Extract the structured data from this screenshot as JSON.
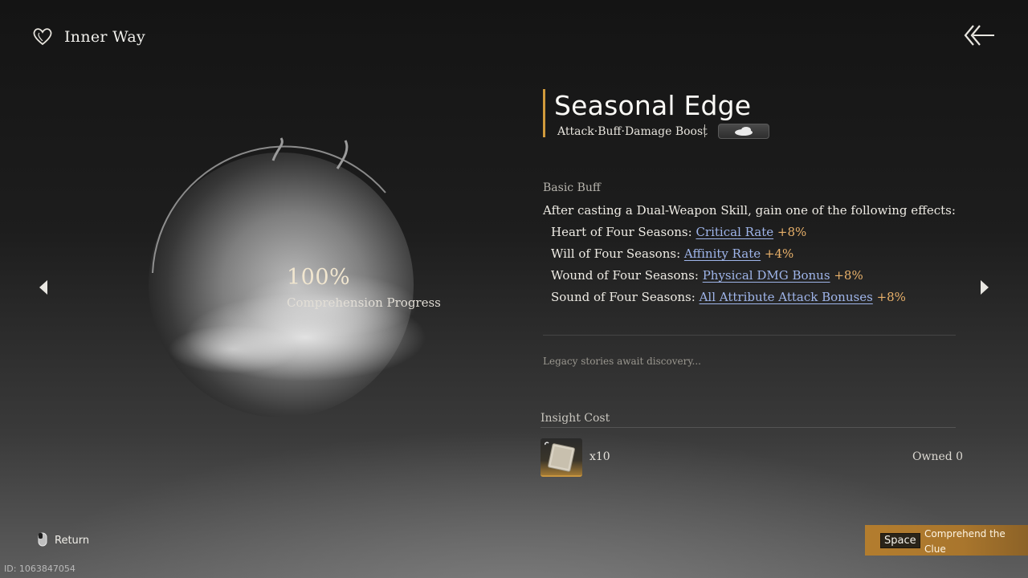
{
  "header": {
    "title": "Inner Way",
    "heart_icon": "heart-icon",
    "back_icon": "arrow-back-icon"
  },
  "orb": {
    "progress_value": "100%",
    "progress_label": "Comprehension Progress",
    "progress_fraction": 1.0
  },
  "nav": {
    "prev_icon": "chevron-left-icon",
    "next_icon": "chevron-right-icon"
  },
  "skill": {
    "name": "Seasonal Edge",
    "tags": "Attack·Buff·Damage Boost",
    "accent_color": "#d09a3c",
    "basic_buff_label": "Basic Buff",
    "description": "After casting a Dual-Weapon Skill, gain one of the following effects:",
    "effects": [
      {
        "prefix": "Heart of Four Seasons: ",
        "stat": "Critical Rate",
        "bonus": "+8%"
      },
      {
        "prefix": "Will of Four Seasons: ",
        "stat": "Affinity Rate",
        "bonus": "+4%"
      },
      {
        "prefix": "Wound of Four Seasons: ",
        "stat": "Physical DMG Bonus",
        "bonus": "+8%"
      },
      {
        "prefix": "Sound of Four Seasons: ",
        "stat": "All Attribute Attack Bonuses",
        "bonus": "+8%"
      }
    ],
    "legacy_text": "Legacy stories await discovery..."
  },
  "cost": {
    "label": "Insight Cost",
    "quantity": "x10",
    "owned": "Owned 0"
  },
  "footer": {
    "return_label": "Return",
    "key_label": "Space",
    "comprehend_label": "Comprehend the Clue",
    "id_text": "ID: 1063847054"
  }
}
